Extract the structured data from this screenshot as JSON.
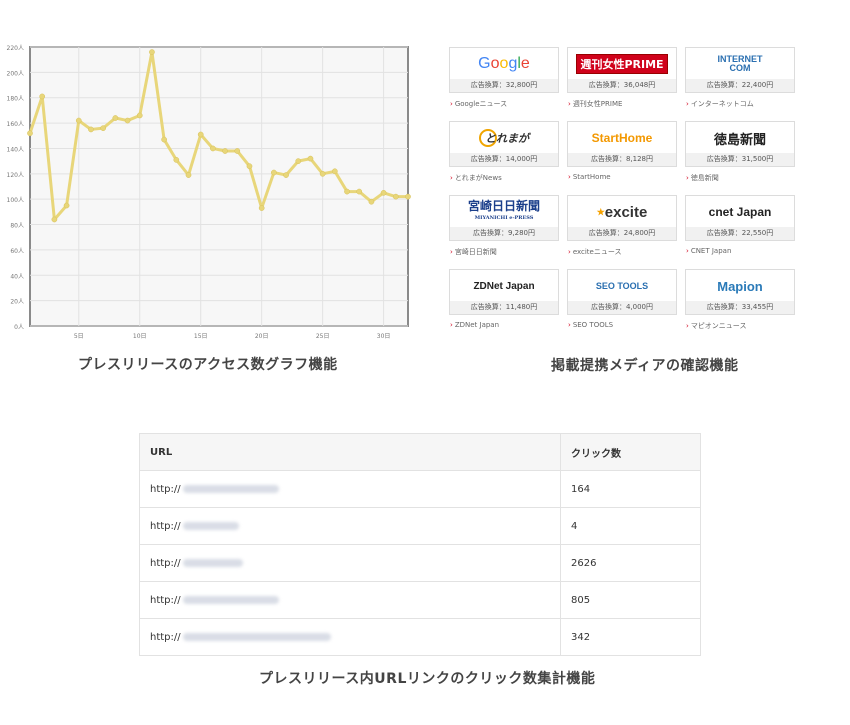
{
  "chart_data": {
    "type": "line",
    "y_unit_suffix": "人",
    "ylim": [
      0,
      220
    ],
    "yticks": [
      0,
      20,
      40,
      60,
      80,
      100,
      120,
      140,
      160,
      180,
      200,
      220
    ],
    "ytick_labels": [
      "0人",
      "20人",
      "40人",
      "60人",
      "80人",
      "100人",
      "120人",
      "140人",
      "160人",
      "180人",
      "200人",
      "220人"
    ],
    "xticks": [
      5,
      10,
      15,
      20,
      25,
      30
    ],
    "xtick_labels": [
      "5日",
      "10日",
      "15日",
      "20日",
      "25日",
      "30日"
    ],
    "x": [
      1,
      2,
      3,
      4,
      5,
      6,
      7,
      8,
      9,
      10,
      11,
      12,
      13,
      14,
      15,
      16,
      17,
      18,
      19,
      20,
      21,
      22,
      23,
      24,
      25,
      26,
      27,
      28,
      29,
      30,
      31,
      32
    ],
    "values": [
      152,
      181,
      84,
      95,
      162,
      155,
      156,
      164,
      162,
      166,
      216,
      147,
      131,
      119,
      151,
      140,
      138,
      138,
      126,
      93,
      121,
      119,
      130,
      132,
      120,
      122,
      106,
      106,
      98,
      105,
      102,
      102
    ],
    "line_color": "#e8d67a",
    "grid": true
  },
  "captions": {
    "chart": "プレスリリースのアクセス数グラフ機能",
    "media": "掲載提携メディアの確認機能",
    "table": "プレスリリース内URLリンクのクリック数集計機能"
  },
  "media": [
    {
      "logo": "Google",
      "stat": "広告換算：32,800円",
      "link": "Googleニュース"
    },
    {
      "logo": "週刊女性PRIME",
      "stat": "広告換算：36,048円",
      "link": "週刊女性PRIME"
    },
    {
      "logo": "INTERNET COM",
      "stat": "広告換算：22,400円",
      "link": "インターネットコム"
    },
    {
      "logo": "とれまが",
      "stat": "広告換算：14,000円",
      "link": "とれまがNews"
    },
    {
      "logo": "StartHome",
      "stat": "広告換算：8,128円",
      "link": "StartHome"
    },
    {
      "logo": "徳島新聞",
      "stat": "広告換算：31,500円",
      "link": "徳島新聞"
    },
    {
      "logo": "宮崎日日新聞",
      "logo_sub": "MIYANICHI e-PRESS",
      "stat": "広告換算：9,280円",
      "link": "宮崎日日新聞"
    },
    {
      "logo": "excite",
      "stat": "広告換算：24,800円",
      "link": "exciteニュース"
    },
    {
      "logo": "cnet Japan",
      "stat": "広告換算：22,550円",
      "link": "CNET Japan"
    },
    {
      "logo": "ZDNet Japan",
      "stat": "広告換算：11,480円",
      "link": "ZDNet Japan"
    },
    {
      "logo": "SEO TOOLS",
      "stat": "広告換算：4,000円",
      "link": "SEO TOOLS"
    },
    {
      "logo": "Mapion",
      "stat": "広告換算：33,455円",
      "link": "マピオンニュース"
    }
  ],
  "table": {
    "headers": [
      "URL",
      "クリック数"
    ],
    "rows": [
      {
        "url_prefix": "http://",
        "clicks": "164"
      },
      {
        "url_prefix": "http://",
        "clicks": "4"
      },
      {
        "url_prefix": "http://",
        "clicks": "2626"
      },
      {
        "url_prefix": "http://",
        "clicks": "805"
      },
      {
        "url_prefix": "http://",
        "clicks": "342"
      }
    ]
  }
}
